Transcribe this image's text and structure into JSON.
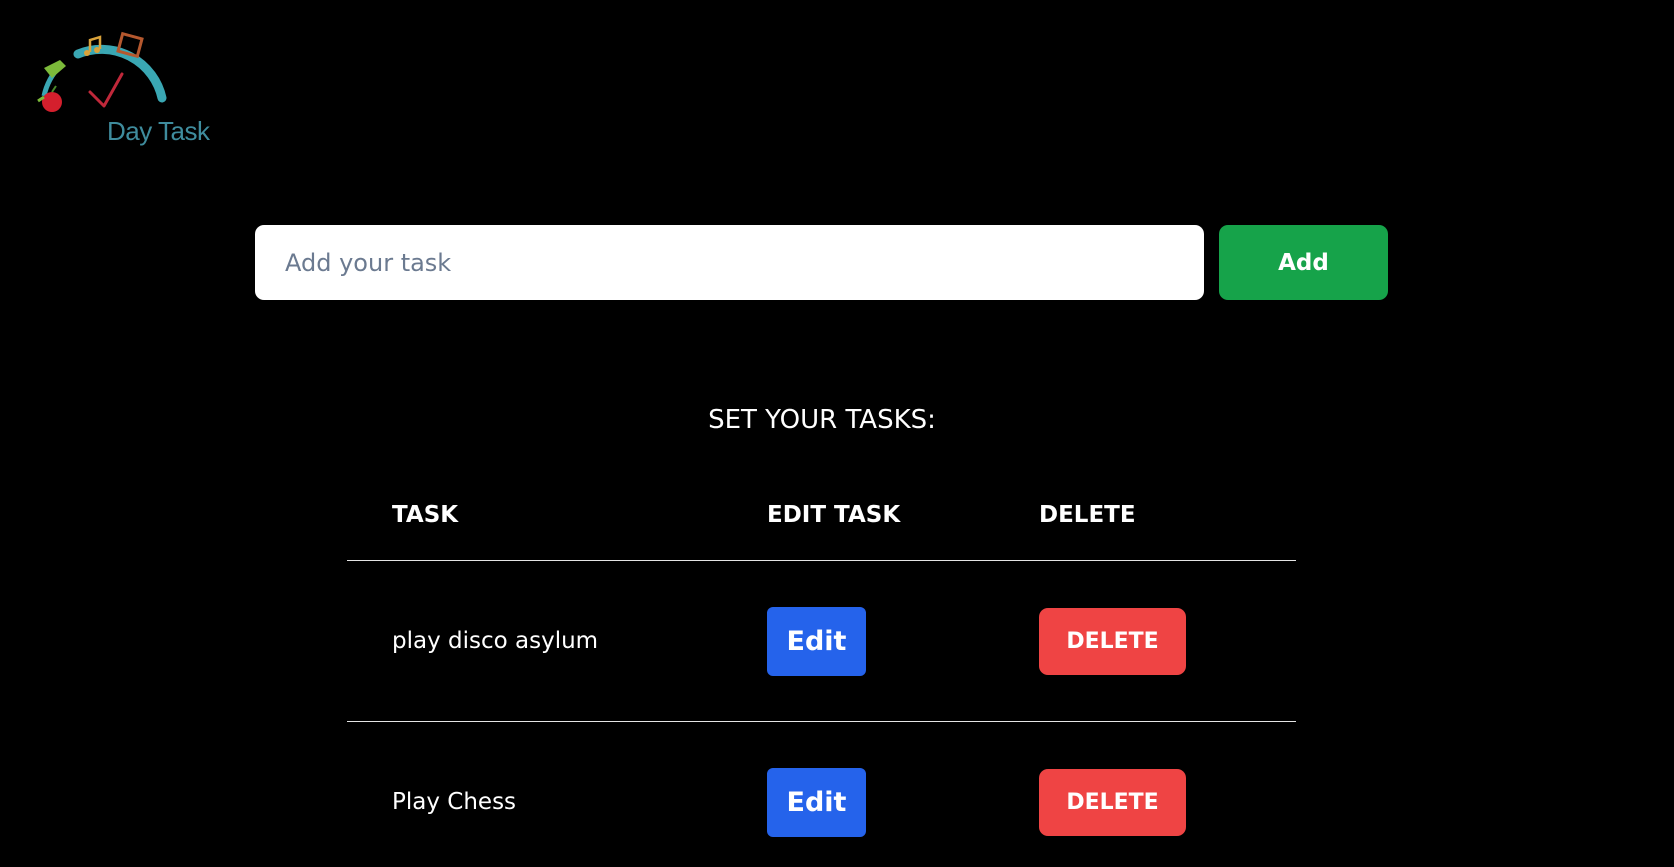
{
  "logo": {
    "text": "Day Task"
  },
  "input": {
    "placeholder": "Add your task",
    "value": ""
  },
  "add_button": {
    "label": "Add"
  },
  "section_title": "SET YOUR TASKS:",
  "table": {
    "headers": {
      "task": "TASK",
      "edit": "EDIT TASK",
      "delete": "DELETE"
    },
    "rows": [
      {
        "task": "play disco asylum",
        "edit_label": "Edit",
        "delete_label": "DELETE"
      },
      {
        "task": "Play Chess",
        "edit_label": "Edit",
        "delete_label": "DELETE"
      }
    ]
  },
  "colors": {
    "background": "#000000",
    "add": "#16a34a",
    "edit": "#2563eb",
    "delete": "#ef4444",
    "logo_text": "#3f8c9d"
  }
}
